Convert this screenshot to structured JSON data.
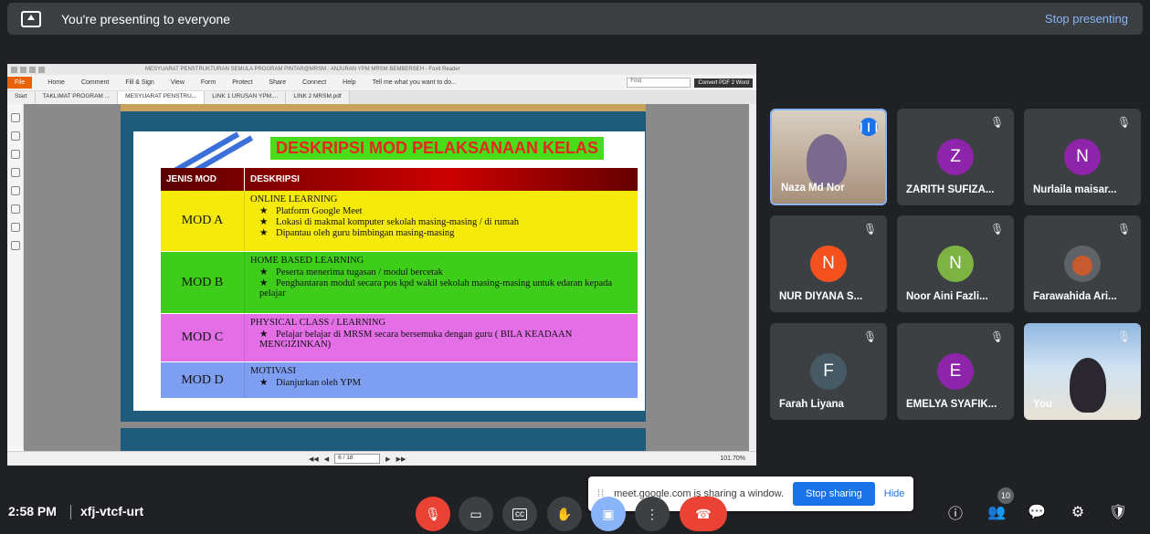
{
  "banner": {
    "text": "You're presenting to everyone",
    "stop_label": "Stop presenting"
  },
  "pdf": {
    "title": "MESYUARAT PENSTRUKTURAN SEMULA PROGRAM PINTAR@MRSM : ANJURAN YPM MRSM BEMBERSEH - Foxit Reader",
    "menu": [
      "Home",
      "Comment",
      "Fill & Sign",
      "View",
      "Form",
      "Protect",
      "Share",
      "Connect",
      "Help"
    ],
    "file_label": "File",
    "tell_me": "Tell me what you want to do...",
    "find_placeholder": "Find",
    "convert_label": "Convert PDF 2 Word",
    "tabs": [
      "Start",
      "TAKLIMAT PROGRAM ...",
      "MESYUARAT PENSTRU...",
      "LINK 1 URUSAN YPM....",
      "LINK 2 MRSM.pdf"
    ],
    "page_indicator": "6 / 18",
    "zoom": "101.70%"
  },
  "slide": {
    "title": "DESKRIPSI MOD PELAKSANAAN KELAS",
    "col1": "JENIS MOD",
    "col2": "DESKRIPSI",
    "rows": [
      {
        "mod": "MOD A",
        "heading": "ONLINE LEARNING",
        "items": [
          "Platform Google Meet",
          "Lokasi di makmal komputer sekolah masing-masing / di rumah",
          "Dipantau oleh guru bimbingan masing-masing"
        ],
        "color": "#f5ea0a"
      },
      {
        "mod": "MOD B",
        "heading": "HOME BASED LEARNING",
        "items": [
          "Peserta menerima tugasan / modul bercetak",
          "Penghantaran modul secara pos kpd wakil sekolah masing-masing untuk edaran kepada pelajar"
        ],
        "color": "#3fcd1c"
      },
      {
        "mod": "MOD C",
        "heading": "PHYSICAL CLASS / LEARNING",
        "items": [
          "Pelajar belajar di MRSM secara bersemuka dengan guru ( BILA KEADAAN MENGIZINKAN)"
        ],
        "color": "#e36ee6"
      },
      {
        "mod": "MOD D",
        "heading": "MOTIVASI",
        "items": [
          "Dianjurkan oleh YPM"
        ],
        "color": "#7e9ef2"
      }
    ]
  },
  "participants": [
    {
      "name": "Naza Md Nor",
      "initial": "",
      "color": "",
      "speaking": true
    },
    {
      "name": "ZARITH SUFIZA...",
      "initial": "Z",
      "color": "#8e24aa"
    },
    {
      "name": "Nurlaila maisar...",
      "initial": "N",
      "color": "#8e24aa"
    },
    {
      "name": "NUR DIYANA S...",
      "initial": "N",
      "color": "#f4511e"
    },
    {
      "name": "Noor Aini Fazli...",
      "initial": "N",
      "color": "#7cb342"
    },
    {
      "name": "Farawahida Ari...",
      "initial": "",
      "color": ""
    },
    {
      "name": "Farah Liyana",
      "initial": "F",
      "color": "#455a64"
    },
    {
      "name": "EMELYA SYAFIK...",
      "initial": "E",
      "color": "#8e24aa"
    },
    {
      "name": "You",
      "initial": "",
      "color": ""
    }
  ],
  "notification": {
    "text": "meet.google.com is sharing a window.",
    "stop_label": "Stop sharing",
    "hide_label": "Hide"
  },
  "bottom": {
    "time": "2:58 PM",
    "meeting_code": "xfj-vtcf-urt",
    "participant_count": "10"
  }
}
